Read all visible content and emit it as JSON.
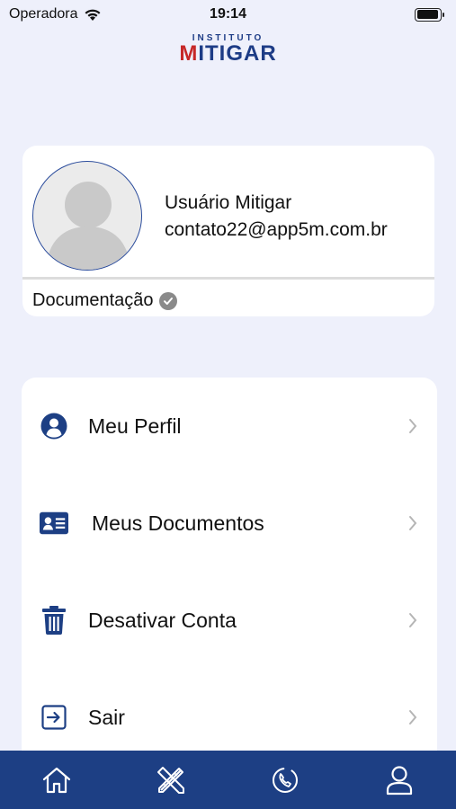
{
  "status_bar": {
    "carrier": "Operadora",
    "time": "19:14"
  },
  "logo": {
    "top_text": "INSTITUTO",
    "main_prefix": "M",
    "main_rest": "ITIGAR"
  },
  "profile": {
    "name": "Usuário Mitigar",
    "email": "contato22@app5m.com.br",
    "documentation_label": "Documentação"
  },
  "menu": {
    "items": [
      {
        "label": "Meu Perfil",
        "icon": "user-circle-icon"
      },
      {
        "label": "Meus Documentos",
        "icon": "id-card-icon"
      },
      {
        "label": "Desativar Conta",
        "icon": "trash-icon"
      },
      {
        "label": "Sair",
        "icon": "logout-icon"
      }
    ]
  },
  "tab_bar": {
    "tabs": [
      "home-icon",
      "tools-icon",
      "phone-icon",
      "user-icon"
    ]
  },
  "colors": {
    "brand_blue": "#1d3f84",
    "brand_red": "#c62828",
    "background": "#eef0fb"
  }
}
